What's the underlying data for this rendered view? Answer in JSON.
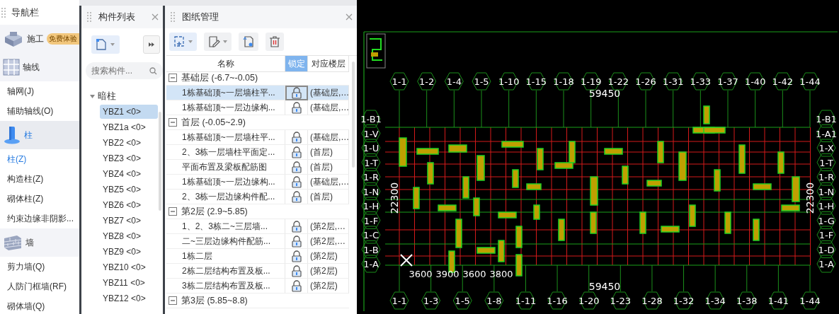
{
  "navigator": {
    "title": "导航栏",
    "items": [
      {
        "kind": "group",
        "label": "施工",
        "badge": "免费体验",
        "selected": false
      },
      {
        "kind": "group",
        "label": "轴线",
        "selected": false
      },
      {
        "kind": "item",
        "label": "轴网(J)",
        "selected": false
      },
      {
        "kind": "item",
        "label": "辅助轴线(O)",
        "selected": false
      },
      {
        "kind": "group",
        "label": "柱",
        "selected": true
      },
      {
        "kind": "item",
        "label": "柱(Z)",
        "selected": true
      },
      {
        "kind": "item",
        "label": "构造柱(Z)",
        "selected": false
      },
      {
        "kind": "item",
        "label": "砌体柱(Z)",
        "selected": false
      },
      {
        "kind": "item",
        "label": "约束边缘非阴影...",
        "selected": false
      },
      {
        "kind": "group",
        "label": "墙",
        "selected": false
      },
      {
        "kind": "item",
        "label": "剪力墙(Q)",
        "selected": false
      },
      {
        "kind": "item",
        "label": "人防门框墙(RF)",
        "selected": false
      },
      {
        "kind": "item",
        "label": "砌体墙(Q)",
        "selected": false
      }
    ]
  },
  "component_list": {
    "title": "构件列表",
    "search": {
      "placeholder": "搜索构件..."
    },
    "tree": [
      {
        "label": "暗柱",
        "expanded": true,
        "children": [
          {
            "label": "YBZ1 <0>",
            "selected": true
          },
          {
            "label": "YBZ1a <0>",
            "selected": false
          },
          {
            "label": "YBZ2 <0>",
            "selected": false
          },
          {
            "label": "YBZ3 <0>",
            "selected": false
          },
          {
            "label": "YBZ4 <0>",
            "selected": false
          },
          {
            "label": "YBZ5 <0>",
            "selected": false
          },
          {
            "label": "YBZ6 <0>",
            "selected": false
          },
          {
            "label": "YBZ7 <0>",
            "selected": false
          },
          {
            "label": "YBZ8 <0>",
            "selected": false
          },
          {
            "label": "YBZ9 <0>",
            "selected": false
          },
          {
            "label": "YBZ10 <0>",
            "selected": false
          },
          {
            "label": "YBZ11 <0>",
            "selected": false
          },
          {
            "label": "YBZ12 <0>",
            "selected": false
          }
        ]
      }
    ]
  },
  "drawing_manager": {
    "title": "图纸管理",
    "columns": [
      {
        "label": "名称",
        "selected": false
      },
      {
        "label": "锁定",
        "selected": true
      },
      {
        "label": "对应楼层",
        "selected": false
      }
    ],
    "groups": [
      {
        "label": "基础层 (-6.7~-0.05)",
        "expanded": true,
        "rows": [
          {
            "name": "1栋基础顶~一层墙柱平...",
            "locked": true,
            "floor": "(基础层,…",
            "selected": true
          },
          {
            "name": "1栋基础顶~一层边缘构...",
            "locked": true,
            "floor": "(基础层,…",
            "selected": false
          }
        ]
      },
      {
        "label": "首层 (-0.05~2.9)",
        "expanded": true,
        "rows": [
          {
            "name": "1栋基础顶~一层墙柱平...",
            "locked": true,
            "floor": "(基础层,…",
            "selected": false
          },
          {
            "name": "2、3栋一层墙柱平面定...",
            "locked": true,
            "floor": "(首层)",
            "selected": false
          },
          {
            "name": "平面布置及梁板配筋图",
            "locked": true,
            "floor": "(首层)",
            "selected": false
          },
          {
            "name": "1栋基础顶~一层边缘构...",
            "locked": true,
            "floor": "(基础层,…",
            "selected": false
          },
          {
            "name": "2、3栋一层边缘构件配...",
            "locked": true,
            "floor": "(首层)",
            "selected": false
          }
        ]
      },
      {
        "label": "第2层 (2.9~5.85)",
        "expanded": true,
        "rows": [
          {
            "name": "1、2、3栋二~三层墙...",
            "locked": true,
            "floor": "(第2层,…",
            "selected": false
          },
          {
            "name": "二~三层边缘构件配筋...",
            "locked": true,
            "floor": "(第2层,…",
            "selected": false
          },
          {
            "name": "1栋二层",
            "locked": true,
            "floor": "(第2层)",
            "selected": false
          },
          {
            "name": "2栋二层结构布置及板...",
            "locked": true,
            "floor": "(第2层)",
            "selected": false
          },
          {
            "name": "3栋二层结构布置及板...",
            "locked": true,
            "floor": "(第2层)",
            "selected": false
          }
        ]
      },
      {
        "label": "第3层 (5.85~8.8)",
        "expanded": true
      }
    ]
  },
  "canvas": {
    "top_axes": [
      "1-1",
      "1-2",
      "1-4",
      "1-5",
      "1-10",
      "1-15",
      "1-18",
      "1-19",
      "1-22",
      "1-26",
      "1-31",
      "1-33",
      "1-37",
      "1-40",
      "1-42",
      "1-44"
    ],
    "bottom_axes": [
      "1-1",
      "1-3",
      "1-5",
      "1-8",
      "1-11",
      "1-16",
      "1-20",
      "1-23",
      "1-28",
      "1-32",
      "1-34",
      "1-38",
      "1-41",
      "1-44"
    ],
    "left_axes": [
      "1-B1",
      "1-V",
      "1-U",
      "1-T",
      "1-R",
      "1-N",
      "1-H",
      "1-F",
      "1-C",
      "1-B",
      "1-A"
    ],
    "right_axes": [
      "1-B1",
      "1-A1",
      "1-X",
      "1-T",
      "1-R",
      "1-N",
      "1-H",
      "1-G",
      "1-F",
      "1-D",
      "1-A"
    ],
    "top_total": "59450",
    "bottom_total": "59450",
    "bottom_spans": [
      "3600",
      "3900",
      "3600",
      "3800"
    ],
    "left_total": "22300",
    "right_total": "22300"
  }
}
